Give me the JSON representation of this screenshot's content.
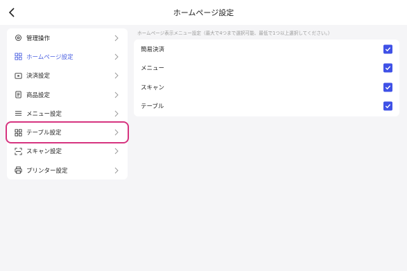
{
  "header": {
    "title": "ホームページ設定"
  },
  "sidebar": {
    "items": [
      {
        "label": "管理操作",
        "icon": "gear-icon"
      },
      {
        "label": "ホームページ設定",
        "icon": "grid-icon",
        "active": true
      },
      {
        "label": "決済設定",
        "icon": "payment-icon"
      },
      {
        "label": "商品設定",
        "icon": "document-icon"
      },
      {
        "label": "メニュー設定",
        "icon": "menu-icon"
      },
      {
        "label": "テーブル設定",
        "icon": "table-grid-icon",
        "highlighted": true
      },
      {
        "label": "スキャン設定",
        "icon": "scan-icon"
      },
      {
        "label": "プリンター設定",
        "icon": "printer-icon"
      }
    ]
  },
  "main": {
    "hint": "ホームページ表示メニュー設定（最大で4つまで選択可能、最低で1つ以上選択してください。）",
    "options": [
      {
        "label": "簡易決済",
        "checked": true
      },
      {
        "label": "メニュー",
        "checked": true
      },
      {
        "label": "スキャン",
        "checked": true
      },
      {
        "label": "テーブル",
        "checked": true
      }
    ]
  },
  "colors": {
    "accent": "#3f51e6",
    "active_text": "#4a5fe0",
    "highlight": "#d6337f"
  }
}
